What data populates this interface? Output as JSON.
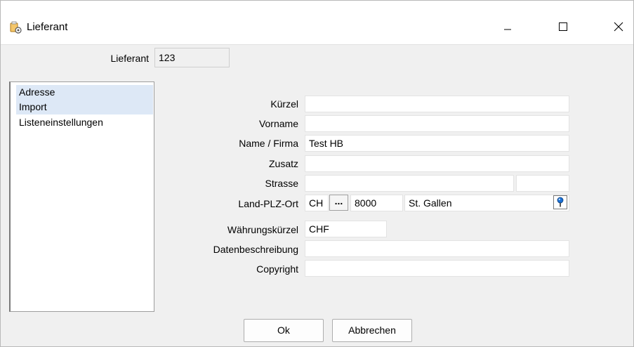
{
  "window": {
    "title": "Lieferant"
  },
  "header": {
    "lieferant_label": "Lieferant",
    "lieferant_value": "123"
  },
  "nav": {
    "items": [
      {
        "label": "Adresse",
        "selected": true
      },
      {
        "label": "Import",
        "selected": true
      },
      {
        "label": "Listeneinstellungen",
        "selected": false
      }
    ]
  },
  "form": {
    "kuerzel": {
      "label": "Kürzel",
      "value": ""
    },
    "vorname": {
      "label": "Vorname",
      "value": ""
    },
    "name": {
      "label": "Name / Firma",
      "value": "Test HB"
    },
    "zusatz": {
      "label": "Zusatz",
      "value": ""
    },
    "strasse": {
      "label": "Strasse",
      "value": "",
      "nr_value": ""
    },
    "land_plz_ort": {
      "label": "Land-PLZ-Ort",
      "land": "CH",
      "ellipsis": "...",
      "plz": "8000",
      "ort": "St. Gallen"
    },
    "waehrung": {
      "label": "Währungskürzel",
      "value": "CHF"
    },
    "datenbeschreibung": {
      "label": "Datenbeschreibung",
      "value": ""
    },
    "copyright": {
      "label": "Copyright",
      "value": ""
    }
  },
  "buttons": {
    "ok": "Ok",
    "cancel": "Abbrechen"
  },
  "icons": {
    "app": "supplier-gear-icon",
    "lookup": "location-pin-icon",
    "minimize": "minimize-icon",
    "maximize": "maximize-icon",
    "close": "close-icon"
  },
  "colors": {
    "selection": "#dde8f6",
    "window_bg": "#f0f0f0",
    "lookup_pin": "#1a6fd4"
  }
}
